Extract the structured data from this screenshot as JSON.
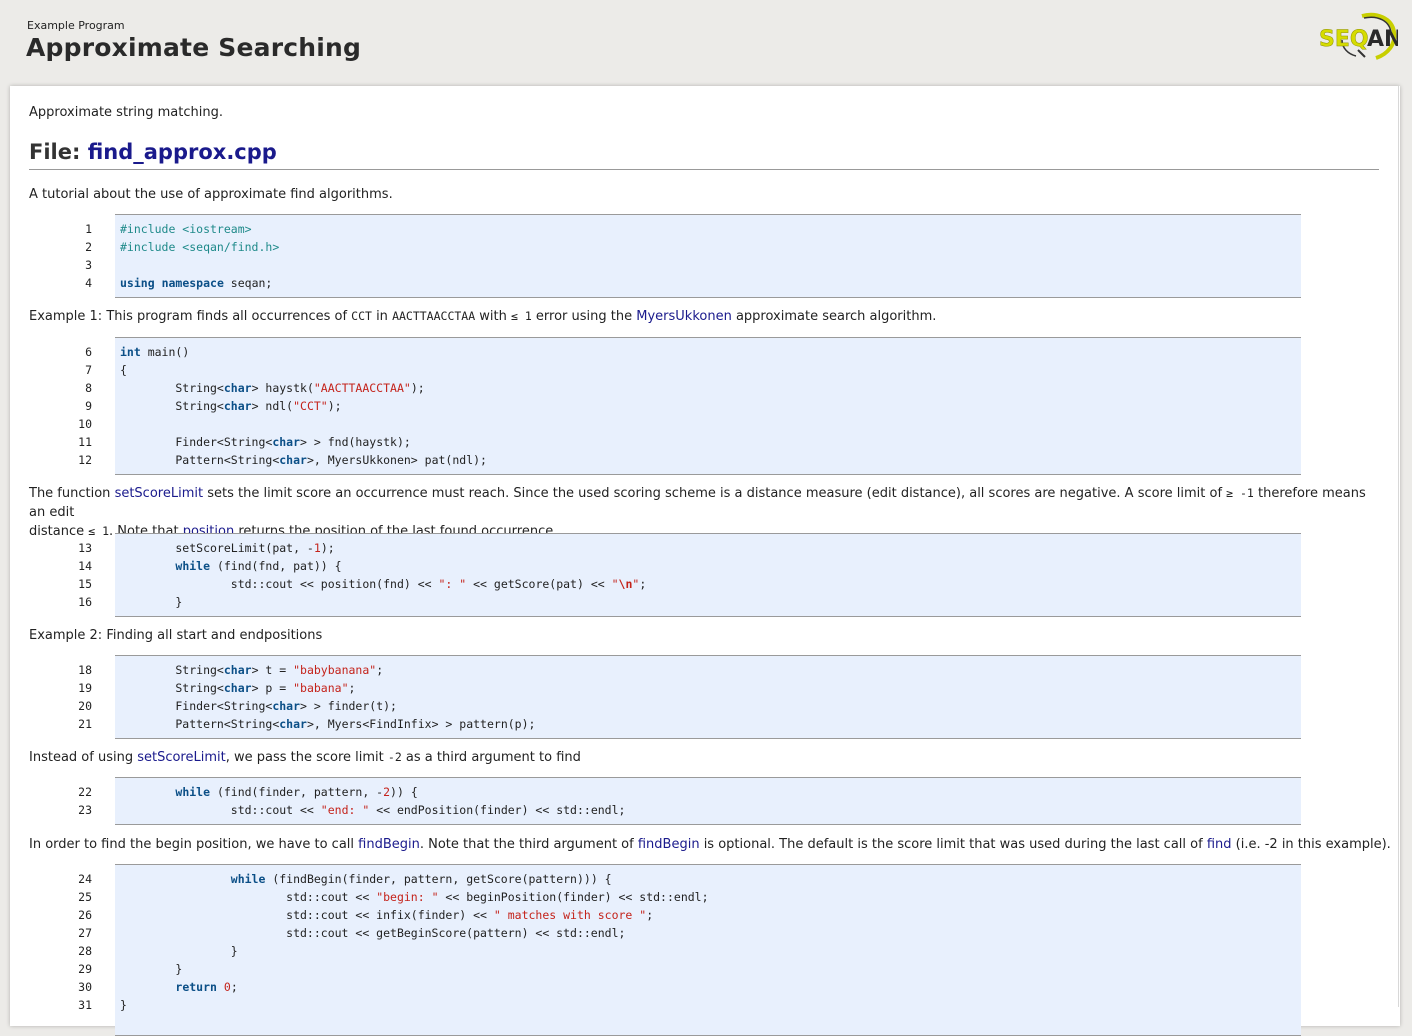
{
  "header": {
    "kicker": "Example Program",
    "title": "Approximate Searching",
    "logo_text": "SEQAN"
  },
  "intro": "Approximate string matching.",
  "file_heading": {
    "prefix": "File: ",
    "filename": "find_approx.cpp"
  },
  "tutorial_line": "A tutorial about the use of approximate find algorithms.",
  "example1": {
    "t1": "Example 1: This program finds all occurrences of ",
    "c1": "CCT",
    "t2": " in ",
    "c2": "AACTTAACCTAA",
    "t3": " with ",
    "c3": "≤ 1",
    "t4": " error using the ",
    "link": "MyersUkkonen",
    "t5": " approximate search algorithm."
  },
  "para_scorelimit": {
    "t1": "The function ",
    "link1": "setScoreLimit",
    "t2": " sets the limit score an occurrence must reach. Since the used scoring scheme is a distance measure (edit distance), all scores are negative. A score limit of ",
    "c1": "≥ -1",
    "t3": " therefore means an edit",
    "t4": "distance ",
    "c2": "≤ 1",
    "t5": ". Note that ",
    "link2": "position",
    "t6": " returns the position of the last found occurrence."
  },
  "example2": "Example 2: Finding all start and endpositions",
  "para_third": {
    "t1": "Instead of using ",
    "link": "setScoreLimit",
    "t2": ", we pass the score limit ",
    "c1": "-2",
    "t3": " as a third argument to find"
  },
  "para_begin": {
    "t1": "In order to find the begin position, we have to call ",
    "link1": "findBegin",
    "t2": ". Note that the third argument of ",
    "link2": "findBegin",
    "t3": " is optional. The default is the score limit that was used during the last call of ",
    "link3": "find",
    "t4": " (i.e. ",
    "c1": "-2",
    "t5": " in this example)."
  },
  "code_blocks": [
    {
      "lines": [
        {
          "n": "1",
          "code": "#include <iostream>"
        },
        {
          "n": "2",
          "code": "#include <seqan/find.h>"
        },
        {
          "n": "3",
          "code": ""
        },
        {
          "n": "4",
          "code": "using namespace seqan;"
        }
      ]
    },
    {
      "lines": [
        {
          "n": "6",
          "code": "int main()"
        },
        {
          "n": "7",
          "code": "{"
        },
        {
          "n": "8",
          "code": "        String<char> haystk(\"AACTTAACCTAA\");"
        },
        {
          "n": "9",
          "code": "        String<char> ndl(\"CCT\");"
        },
        {
          "n": "10",
          "code": ""
        },
        {
          "n": "11",
          "code": "        Finder<String<char> > fnd(haystk);"
        },
        {
          "n": "12",
          "code": "        Pattern<String<char>, MyersUkkonen> pat(ndl);"
        }
      ]
    },
    {
      "lines": [
        {
          "n": "13",
          "code": "        setScoreLimit(pat, -1);"
        },
        {
          "n": "14",
          "code": "        while (find(fnd, pat)) {"
        },
        {
          "n": "15",
          "code": "                std::cout << position(fnd) << \": \" << getScore(pat) << \"\\n\";"
        },
        {
          "n": "16",
          "code": "        }"
        }
      ]
    },
    {
      "lines": [
        {
          "n": "18",
          "code": "        String<char> t = \"babybanana\";"
        },
        {
          "n": "19",
          "code": "        String<char> p = \"babana\";"
        },
        {
          "n": "20",
          "code": "        Finder<String<char> > finder(t);"
        },
        {
          "n": "21",
          "code": "        Pattern<String<char>, Myers<FindInfix> > pattern(p);"
        }
      ]
    },
    {
      "lines": [
        {
          "n": "22",
          "code": "        while (find(finder, pattern, -2)) {"
        },
        {
          "n": "23",
          "code": "                std::cout << \"end: \" << endPosition(finder) << std::endl;"
        }
      ]
    },
    {
      "lines": [
        {
          "n": "24",
          "code": "                while (findBegin(finder, pattern, getScore(pattern))) {"
        },
        {
          "n": "25",
          "code": "                        std::cout << \"begin: \" << beginPosition(finder) << std::endl;"
        },
        {
          "n": "26",
          "code": "                        std::cout << infix(finder) << \" matches with score \";"
        },
        {
          "n": "27",
          "code": "                        std::cout << getBeginScore(pattern) << std::endl;"
        },
        {
          "n": "28",
          "code": "                }"
        },
        {
          "n": "29",
          "code": "        }"
        },
        {
          "n": "30",
          "code": "        return 0;"
        },
        {
          "n": "31",
          "code": "}"
        }
      ]
    }
  ]
}
